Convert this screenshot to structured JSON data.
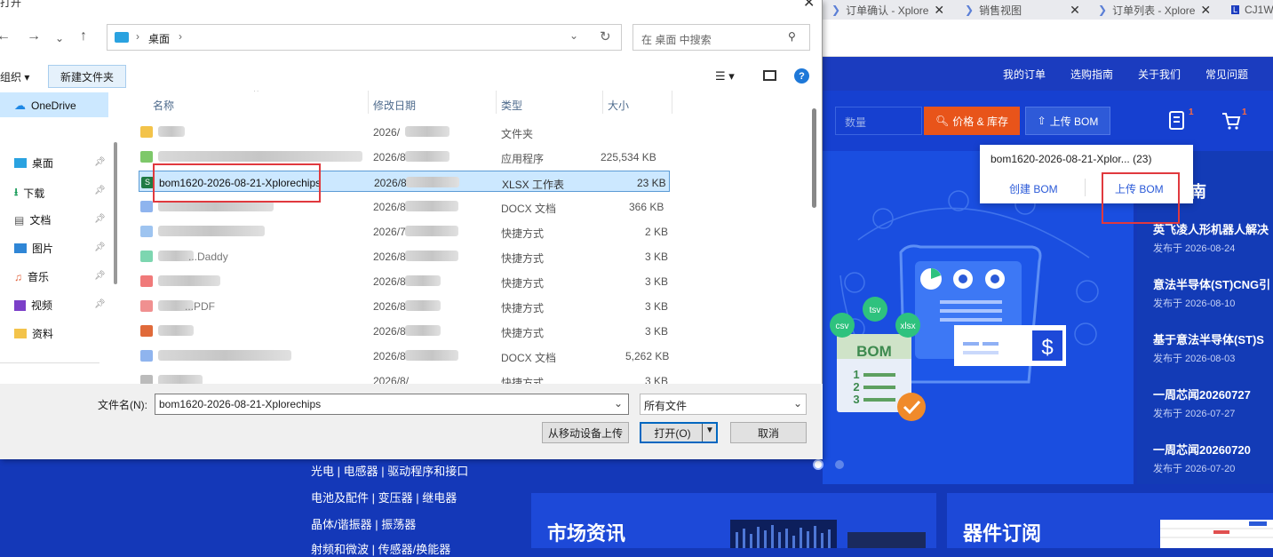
{
  "browser": {
    "tabs": [
      {
        "label": "订单确认 - Xplore"
      },
      {
        "label": "销售视图"
      },
      {
        "label": "订单列表 - Xplore"
      },
      {
        "label": "CJ1W"
      }
    ]
  },
  "site": {
    "nav": [
      "我的订单",
      "选购指南",
      "关于我们",
      "常见问题"
    ],
    "qty_placeholder": "数量",
    "price_btn": "价格 & 库存",
    "upload_btn": "上传 BOM",
    "cart_badge": "1",
    "bom_badge": "1",
    "bom_popup": {
      "filename": "bom1620-2026-08-21-Xplor... (23)",
      "create": "创建 BOM",
      "upload": "上传 BOM"
    },
    "guide_label": "指南",
    "news": [
      {
        "title": "英飞凌人形机器人解决",
        "date": "发布于 2026-08-24"
      },
      {
        "title": "意法半导体(ST)CNG引",
        "date": "发布于 2026-08-10"
      },
      {
        "title": "基于意法半导体(ST)S",
        "date": "发布于 2026-08-03"
      },
      {
        "title": "一周芯闻20260727",
        "date": "发布于 2026-07-27"
      },
      {
        "title": "一周芯闻20260720",
        "date": "发布于 2026-07-20"
      }
    ],
    "hero_labels": {
      "csv": "csv",
      "tsv": "tsv",
      "xlsx": "xlsx",
      "bom": "BOM",
      "l1": "1",
      "l2": "2",
      "l3": "3",
      "dollar": "$"
    },
    "categories": [
      "光电 | 电感器 | 驱动程序和接口",
      "电池及配件 | 变压器 | 继电器",
      "晶体/谐振器 | 振荡器",
      "射频和微波 | 传感器/换能器"
    ],
    "cards": [
      "市场资讯",
      "器件订阅"
    ]
  },
  "dialog": {
    "title": "打开",
    "breadcrumb": [
      "桌面"
    ],
    "search_placeholder": "在 桌面 中搜索",
    "organize": "组织 ▾",
    "new_folder": "新建文件夹",
    "nav": {
      "onedrive": "OneDrive",
      "items": [
        "桌面",
        "下载",
        "文档",
        "图片",
        "音乐",
        "视频",
        "资料"
      ]
    },
    "columns": {
      "name": "名称",
      "date": "修改日期",
      "type": "类型",
      "size": "大小"
    },
    "rows": [
      {
        "name": "",
        "date": "2026/",
        "type": "文件夹",
        "size": ""
      },
      {
        "name": "",
        "date": "2026/8",
        "type": "应用程序",
        "size": "225,534 KB"
      },
      {
        "name": "bom1620-2026-08-21-Xplorechips",
        "date": "2026/8/",
        "type": "XLSX 工作表",
        "size": "23 KB"
      },
      {
        "name": "",
        "date": "2026/8/",
        "type": "DOCX 文档",
        "size": "366 KB"
      },
      {
        "name": "",
        "date": "2026/7/",
        "type": "快捷方式",
        "size": "2 KB"
      },
      {
        "name": "...Daddy",
        "date": "2026/8/",
        "type": "快捷方式",
        "size": "3 KB"
      },
      {
        "name": "",
        "date": "2026/8/",
        "type": "快捷方式",
        "size": "3 KB"
      },
      {
        "name": "...PDF",
        "date": "2026/8/",
        "type": "快捷方式",
        "size": "3 KB"
      },
      {
        "name": "",
        "date": "2026/8/",
        "type": "快捷方式",
        "size": "3 KB"
      },
      {
        "name": "",
        "date": "2026/8/",
        "type": "DOCX 文档",
        "size": "5,262 KB"
      },
      {
        "name": "",
        "date": "2026/8/",
        "type": "快捷方式",
        "size": "3 KB"
      }
    ],
    "filename_label": "文件名(N):",
    "filename_value": "bom1620-2026-08-21-Xplorechips",
    "filetype": "所有文件",
    "upload_mobile": "从移动设备上传",
    "open": "打开(O)",
    "cancel": "取消"
  }
}
